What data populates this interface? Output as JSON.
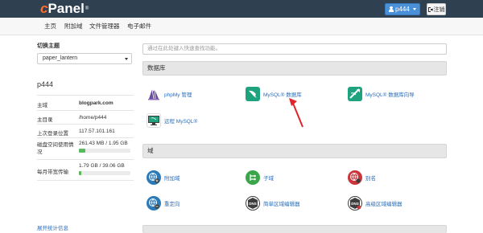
{
  "header": {
    "logo_c": "c",
    "logo_panel": "Panel",
    "logo_tm": "®",
    "user_label": "p444",
    "logout_label": "注销"
  },
  "nav": {
    "items": [
      {
        "label": "主页"
      },
      {
        "label": "附加域"
      },
      {
        "label": "文件管理器"
      },
      {
        "label": "电子邮件"
      }
    ]
  },
  "sidebar": {
    "theme_label": "切换主题",
    "theme_value": "paper_lantern",
    "username": "p444",
    "rows": [
      {
        "key": "主域",
        "value": "blogpark.com"
      },
      {
        "key": "主目录",
        "value": "/home/p444"
      },
      {
        "key": "上次登录位置",
        "value": "117.57.101.161"
      },
      {
        "key": "磁盘空间使用情况",
        "value": "261.43 MB / 1.95 GB",
        "progress_fraction": 0.13
      },
      {
        "key": "每月带宽传输",
        "value": "1.79 GB / 39.06 GB",
        "progress_fraction": 0.05
      }
    ],
    "expand_link": "展开统计信息"
  },
  "main": {
    "search_placeholder": "通过在此处键入快速查找功能。",
    "sections": [
      {
        "title": "数据库",
        "items": [
          {
            "label": "phpMy 管理",
            "icon": "phpmyadmin-icon"
          },
          {
            "label": "MySQL® 数据库",
            "icon": "mysql-database-icon"
          },
          {
            "label": "MySQL® 数据库向导",
            "icon": "mysql-wizard-icon"
          },
          {
            "label": "远程 MySQL®",
            "icon": "remote-mysql-icon"
          }
        ]
      },
      {
        "title": "域",
        "items": [
          {
            "label": "附加域",
            "icon": "addon-domain-icon"
          },
          {
            "label": "子域",
            "icon": "subdomain-icon"
          },
          {
            "label": "别名",
            "icon": "alias-icon"
          },
          {
            "label": "重定向",
            "icon": "redirect-icon"
          },
          {
            "label": "简单区域编辑器",
            "icon": "dns-simple-icon",
            "badge": "DNS"
          },
          {
            "label": "高级区域编辑器",
            "icon": "dns-advanced-icon",
            "badge": "DNS"
          }
        ]
      }
    ]
  },
  "colors": {
    "topbar": "#2f4050",
    "logo_orange": "#ff6c2c",
    "link_blue": "#2a6ebb",
    "progress_green": "#5cb85c",
    "mysql_teal": "#1fa37f",
    "addon_blue": "#2a7ab9",
    "subdomain_green": "#3aa64a",
    "alias_red": "#c9353b",
    "dns_dark": "#3d3d3d",
    "arrow_red": "#e0242a"
  }
}
